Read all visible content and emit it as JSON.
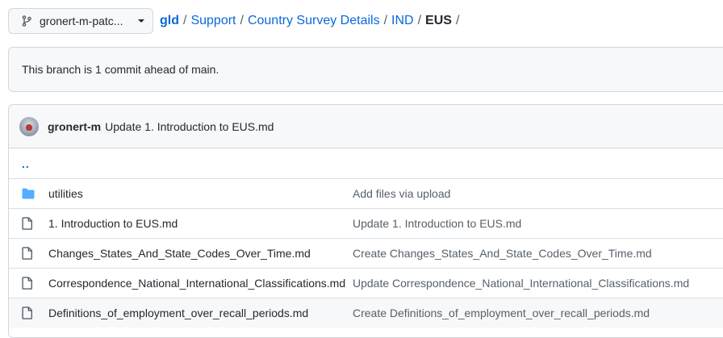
{
  "branch": {
    "label": "gronert-m-patc..."
  },
  "breadcrumb": {
    "root": "gld",
    "items": [
      "Support",
      "Country Survey Details",
      "IND"
    ],
    "current": "EUS",
    "separator": "/"
  },
  "ahead_message": "This branch is 1 commit ahead of main.",
  "latest_commit": {
    "author": "gronert-m",
    "message": "Update 1. Introduction to EUS.md"
  },
  "parent_dir": "..",
  "files": [
    {
      "name": "utilities",
      "type": "directory",
      "icon": "folder-icon",
      "commit": "Add files via upload"
    },
    {
      "name": "1. Introduction to EUS.md",
      "type": "file",
      "icon": "file-icon",
      "commit": "Update 1. Introduction to EUS.md"
    },
    {
      "name": "Changes_States_And_State_Codes_Over_Time.md",
      "type": "file",
      "icon": "file-icon",
      "commit": "Create Changes_States_And_State_Codes_Over_Time.md"
    },
    {
      "name": "Correspondence_National_International_Classifications.md",
      "type": "file",
      "icon": "file-icon",
      "commit": "Update Correspondence_National_International_Classifications.md"
    },
    {
      "name": "Definitions_of_employment_over_recall_periods.md",
      "type": "file",
      "icon": "file-icon",
      "commit": "Create Definitions_of_employment_over_recall_periods.md"
    }
  ],
  "colors": {
    "link": "#0969da",
    "folder": "#54aeff",
    "border": "#d0d7de",
    "muted": "#57606a",
    "panel_bg": "#f6f8fa"
  }
}
